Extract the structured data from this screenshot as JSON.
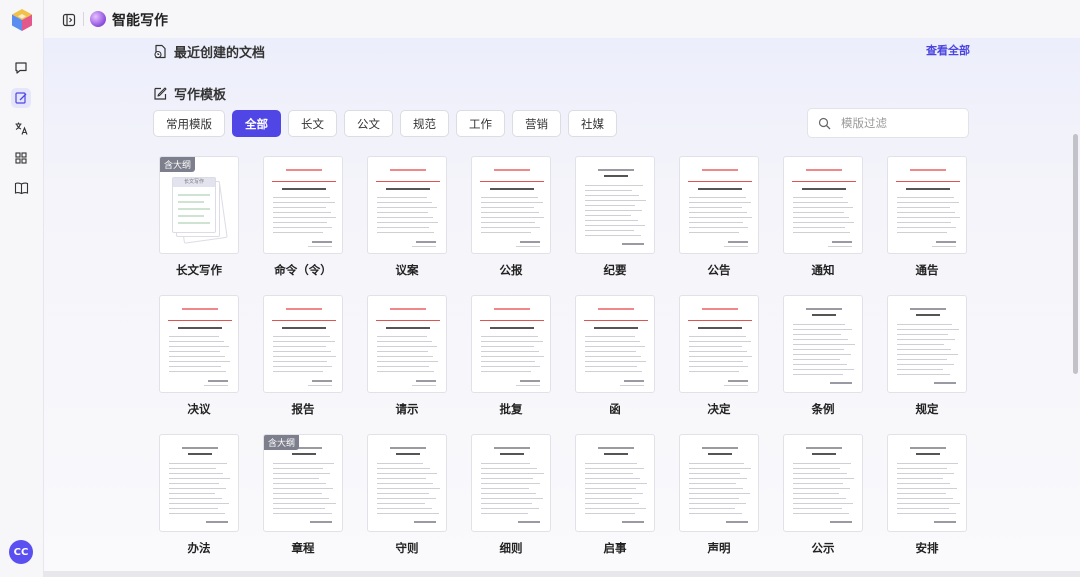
{
  "app": {
    "title": "智能写作"
  },
  "user": {
    "initials": "CC"
  },
  "sidebar": {
    "icons": [
      "logo-cube-icon",
      "chat-icon",
      "edit-doc-icon",
      "translate-icon",
      "grid-apps-icon",
      "book-icon"
    ]
  },
  "recent": {
    "title": "最近创建的文档",
    "view_all": "查看全部"
  },
  "templates": {
    "title": "写作模板",
    "tabs": [
      {
        "label": "常用模版",
        "active": false
      },
      {
        "label": "全部",
        "active": true
      },
      {
        "label": "长文",
        "active": false
      },
      {
        "label": "公文",
        "active": false
      },
      {
        "label": "规范",
        "active": false
      },
      {
        "label": "工作",
        "active": false
      },
      {
        "label": "营销",
        "active": false
      },
      {
        "label": "社媒",
        "active": false
      }
    ],
    "filter_placeholder": "模版过滤",
    "items": [
      {
        "label": "长文写作",
        "badge": "含大纲",
        "style": "stack",
        "thumb_header": "长文写作"
      },
      {
        "label": "命令（令）",
        "badge": "",
        "style": "red"
      },
      {
        "label": "议案",
        "badge": "",
        "style": "red"
      },
      {
        "label": "公报",
        "badge": "",
        "style": "red"
      },
      {
        "label": "纪要",
        "badge": "",
        "style": "plain"
      },
      {
        "label": "公告",
        "badge": "",
        "style": "red"
      },
      {
        "label": "通知",
        "badge": "",
        "style": "red"
      },
      {
        "label": "通告",
        "badge": "",
        "style": "red"
      },
      {
        "label": "决议",
        "badge": "",
        "style": "red"
      },
      {
        "label": "报告",
        "badge": "",
        "style": "red"
      },
      {
        "label": "请示",
        "badge": "",
        "style": "red"
      },
      {
        "label": "批复",
        "badge": "",
        "style": "red"
      },
      {
        "label": "函",
        "badge": "",
        "style": "red"
      },
      {
        "label": "决定",
        "badge": "",
        "style": "red"
      },
      {
        "label": "条例",
        "badge": "",
        "style": "plain"
      },
      {
        "label": "规定",
        "badge": "",
        "style": "plain"
      },
      {
        "label": "办法",
        "badge": "",
        "style": "plain"
      },
      {
        "label": "章程",
        "badge": "含大纲",
        "style": "plain"
      },
      {
        "label": "守则",
        "badge": "",
        "style": "plain"
      },
      {
        "label": "细则",
        "badge": "",
        "style": "plain"
      },
      {
        "label": "启事",
        "badge": "",
        "style": "plain"
      },
      {
        "label": "声明",
        "badge": "",
        "style": "plain"
      },
      {
        "label": "公示",
        "badge": "",
        "style": "plain"
      },
      {
        "label": "安排",
        "badge": "",
        "style": "plain"
      }
    ]
  },
  "colors": {
    "accent": "#4f46e5",
    "red_header": "#e05353",
    "badge": "#7d7f8c"
  }
}
